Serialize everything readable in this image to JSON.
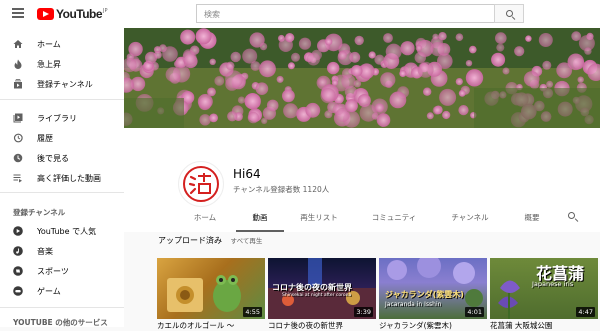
{
  "header": {
    "logo_text": "YouTube",
    "logo_region": "JP",
    "search_placeholder": "検索"
  },
  "sidebar": {
    "items": [
      {
        "label": "ホーム",
        "icon": "home-icon"
      },
      {
        "label": "急上昇",
        "icon": "flame-icon"
      },
      {
        "label": "登録チャンネル",
        "icon": "subscriptions-icon"
      },
      {
        "label": "ライブラリ",
        "icon": "library-icon"
      },
      {
        "label": "履歴",
        "icon": "history-icon"
      },
      {
        "label": "後で見る",
        "icon": "watch-later-icon"
      },
      {
        "label": "高く評価した動画",
        "icon": "liked-videos-icon"
      }
    ],
    "subs_heading": "登録チャンネル",
    "subs": [
      {
        "label": "YouTube で人気",
        "icon": "popular-icon"
      },
      {
        "label": "音楽",
        "icon": "music-icon"
      },
      {
        "label": "スポーツ",
        "icon": "sports-icon"
      },
      {
        "label": "ゲーム",
        "icon": "gaming-icon"
      }
    ],
    "more_heading": "YOUTUBE の他のサービス"
  },
  "channel": {
    "name": "Hi64",
    "subscribers": "チャンネル登録者数 1120人",
    "tabs": [
      "ホーム",
      "動画",
      "再生リスト",
      "コミュニティ",
      "チャンネル",
      "概要"
    ],
    "active_tab": "動画"
  },
  "uploads": {
    "title": "アップロード済み",
    "play_all": "すべて再生",
    "videos": [
      {
        "duration": "4:55",
        "title": "カエルのオルゴール 〜",
        "overlay": ""
      },
      {
        "duration": "3:39",
        "title": "コロナ後の夜の新世界",
        "overlay": "コロナ後の夜の新世界",
        "overlay_sub": "Shinsekai at night after corona"
      },
      {
        "duration": "4:01",
        "title": "ジャカランダ(紫雲木)",
        "overlay": "ジャカランダ(紫雲木)",
        "overlay_sub": "Jacaranda in Isshin"
      },
      {
        "duration": "4:47",
        "title": "花菖蒲 大阪城公園",
        "overlay": "花菖蒲",
        "overlay_sub": "Japanese iris"
      }
    ]
  },
  "colors": {
    "brand_red": "#ff0000",
    "text": "#030303",
    "muted": "#606060"
  }
}
